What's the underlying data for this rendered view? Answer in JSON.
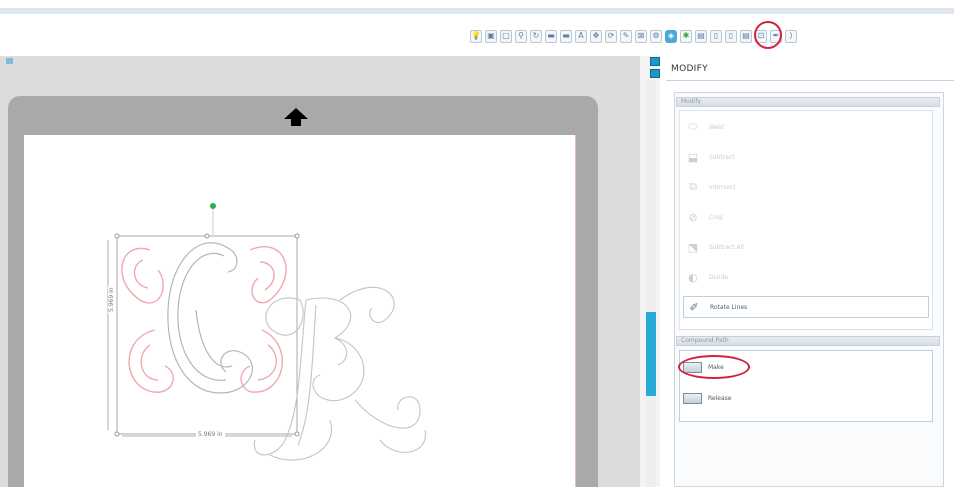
{
  "toolbar": {
    "buttons": [
      {
        "icon": "lightbulb-icon",
        "glyph": "💡"
      },
      {
        "icon": "window-icon",
        "glyph": "▣"
      },
      {
        "icon": "page-icon",
        "glyph": "▢"
      },
      {
        "icon": "zoom-icon",
        "glyph": "⚲"
      },
      {
        "icon": "rotate-icon",
        "glyph": "↻"
      },
      {
        "icon": "align-icon",
        "glyph": "▬"
      },
      {
        "icon": "distribute-icon",
        "glyph": "▬"
      },
      {
        "icon": "text-icon",
        "glyph": "A"
      },
      {
        "icon": "move-icon",
        "glyph": "✥"
      },
      {
        "icon": "replicate-icon",
        "glyph": "⟳"
      },
      {
        "icon": "knife-icon",
        "glyph": "✎"
      },
      {
        "icon": "offset-icon",
        "glyph": "⊠"
      },
      {
        "icon": "trace-icon",
        "glyph": "⚙"
      },
      {
        "icon": "modify-icon",
        "glyph": "◈",
        "selected": true
      },
      {
        "icon": "flexi-icon",
        "glyph": "✱",
        "accent": "#3aa24a"
      },
      {
        "icon": "library-icon",
        "glyph": "▤"
      },
      {
        "icon": "store-icon",
        "glyph": "▯"
      },
      {
        "icon": "cut-settings-icon",
        "glyph": "▯"
      },
      {
        "icon": "send-icon",
        "glyph": "▤"
      },
      {
        "icon": "media-icon",
        "glyph": "⊡"
      },
      {
        "icon": "pen-icon",
        "glyph": "✒"
      },
      {
        "icon": "more-icon",
        "glyph": "⟩"
      }
    ]
  },
  "canvas": {
    "width_label": "5.969 in",
    "height_label": "5.969 in",
    "mat_arrow": "up"
  },
  "panel": {
    "title": "MODIFY",
    "section_modify": "Modify",
    "items": [
      {
        "label": "Weld",
        "icon": "weld-icon",
        "glyph": "⬭",
        "enabled": false
      },
      {
        "label": "Subtract",
        "icon": "subtract-icon",
        "glyph": "⬓",
        "enabled": false
      },
      {
        "label": "Intersect",
        "icon": "intersect-icon",
        "glyph": "⧉",
        "enabled": false
      },
      {
        "label": "Crop",
        "icon": "crop-icon",
        "glyph": "⊘",
        "enabled": false
      },
      {
        "label": "Subtract All",
        "icon": "subtract-all-icon",
        "glyph": "⬔",
        "enabled": false
      },
      {
        "label": "Divide",
        "icon": "divide-icon",
        "glyph": "◐",
        "enabled": false
      },
      {
        "label": "Rotate Lines",
        "icon": "rotate-lines-icon",
        "glyph": "✐",
        "enabled": true
      }
    ],
    "section_compound": "Compound Path",
    "compound_items": [
      {
        "label": "Make",
        "icon": "make-compound-icon"
      },
      {
        "label": "Release",
        "icon": "release-compound-icon"
      }
    ]
  },
  "colors": {
    "highlight": "#d41f3f",
    "accent_blue": "#29a9d8",
    "selection_pink": "#f0a8ae",
    "handle_green": "#25b34a"
  }
}
